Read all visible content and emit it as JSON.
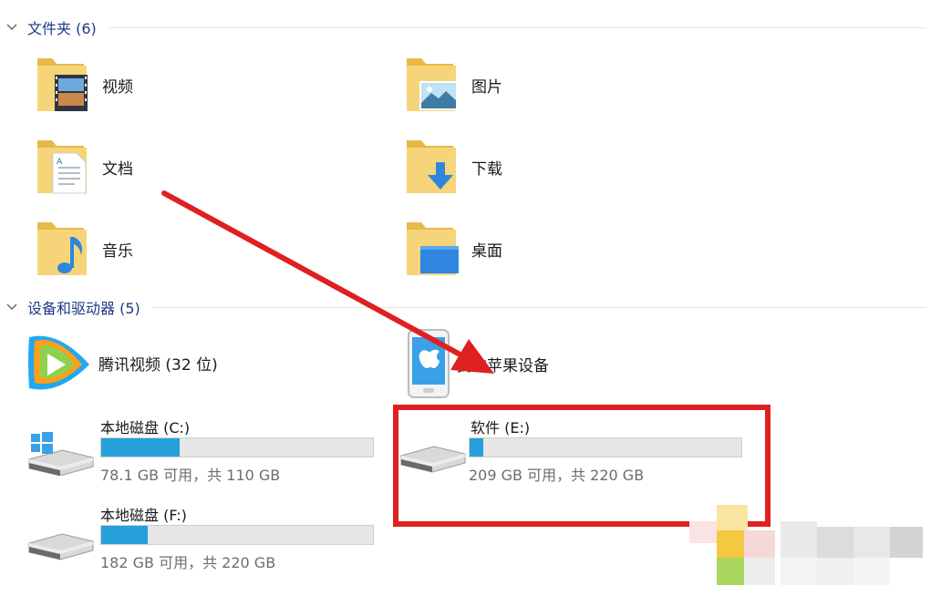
{
  "folders_section": {
    "title": "文件夹 (6)"
  },
  "folders": [
    {
      "label": "视频",
      "icon": "video-folder-icon"
    },
    {
      "label": "图片",
      "icon": "pictures-folder-icon"
    },
    {
      "label": "文档",
      "icon": "documents-folder-icon"
    },
    {
      "label": "下载",
      "icon": "downloads-folder-icon"
    },
    {
      "label": "音乐",
      "icon": "music-folder-icon"
    },
    {
      "label": "桌面",
      "icon": "desktop-folder-icon"
    }
  ],
  "devices_section": {
    "title": "设备和驱动器 (5)"
  },
  "devices": [
    {
      "label": "腾讯视频 (32 位)",
      "icon": "tencent-video-icon"
    },
    {
      "label": "我的苹果设备",
      "icon": "apple-device-icon"
    }
  ],
  "drives": [
    {
      "name": "本地磁盘 (C:)",
      "free_text": "78.1 GB 可用，共 110 GB",
      "used_fraction": 0.29,
      "icon": "windows-drive-icon"
    },
    {
      "name": "软件 (E:)",
      "free_text": "209 GB 可用，共 220 GB",
      "used_fraction": 0.05,
      "icon": "hard-drive-icon"
    },
    {
      "name": "本地磁盘 (F:)",
      "free_text": "182 GB 可用，共 220 GB",
      "used_fraction": 0.17,
      "icon": "hard-drive-icon"
    }
  ],
  "colors": {
    "accent": "#26a0da",
    "section_title": "#1e3a8a",
    "annotation_red": "#e02020",
    "folder_yellow": "#f3cf6a"
  }
}
